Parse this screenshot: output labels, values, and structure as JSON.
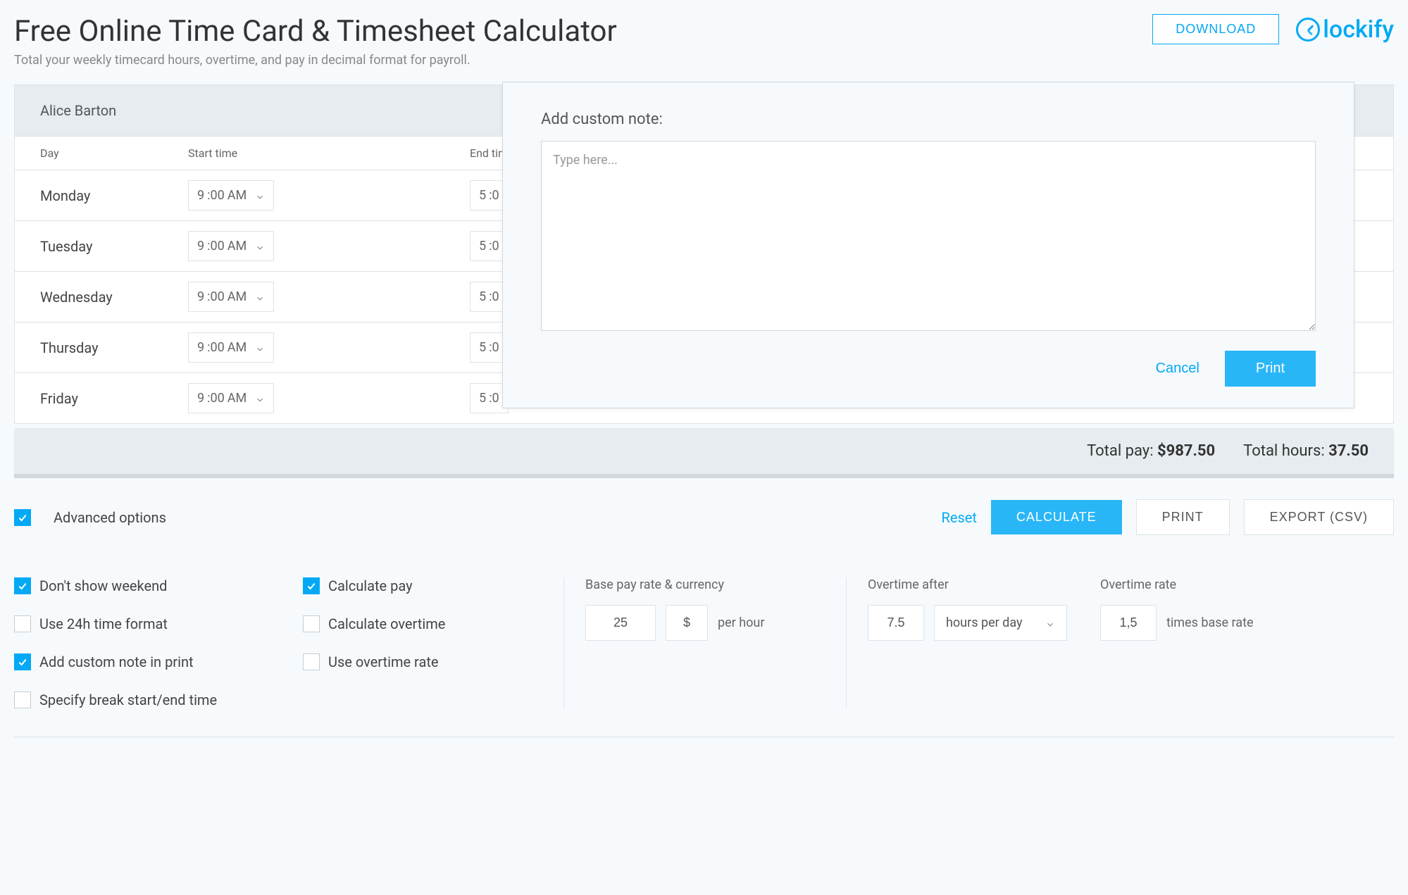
{
  "header": {
    "title": "Free Online Time Card & Timesheet Calculator",
    "subtitle": "Total your weekly timecard hours, overtime, and pay in decimal format for payroll.",
    "download": "DOWNLOAD",
    "brand": "lockify"
  },
  "timesheet": {
    "employee": "Alice Barton",
    "columns": {
      "day": "Day",
      "start": "Start time",
      "end": "End time"
    },
    "rows": [
      {
        "day": "Monday",
        "start_h": "9",
        "start_m": ":00",
        "start_ampm": "AM",
        "end_h": "5",
        "end_m": ":0"
      },
      {
        "day": "Tuesday",
        "start_h": "9",
        "start_m": ":00",
        "start_ampm": "AM",
        "end_h": "5",
        "end_m": ":0"
      },
      {
        "day": "Wednesday",
        "start_h": "9",
        "start_m": ":00",
        "start_ampm": "AM",
        "end_h": "5",
        "end_m": ":0"
      },
      {
        "day": "Thursday",
        "start_h": "9",
        "start_m": ":00",
        "start_ampm": "AM",
        "end_h": "5",
        "end_m": ":0"
      },
      {
        "day": "Friday",
        "start_h": "9",
        "start_m": ":00",
        "start_ampm": "AM",
        "end_h": "5",
        "end_m": ":0"
      }
    ]
  },
  "totals": {
    "pay_label": "Total pay:",
    "pay_value": "$987.50",
    "hours_label": "Total hours:",
    "hours_value": "37.50"
  },
  "actions": {
    "advanced": "Advanced options",
    "reset": "Reset",
    "calculate": "CALCULATE",
    "print": "PRINT",
    "export": "EXPORT (CSV)"
  },
  "options": {
    "dont_show_weekend": "Don't show weekend",
    "use_24h": "Use 24h time format",
    "add_note": "Add custom note in print",
    "specify_break": "Specify break start/end time",
    "calc_pay": "Calculate pay",
    "calc_overtime": "Calculate overtime",
    "use_ot_rate": "Use overtime rate",
    "base_rate_label": "Base pay rate & currency",
    "base_rate_value": "25",
    "currency": "$",
    "per_hour": "per hour",
    "ot_after_label": "Overtime after",
    "ot_after_value": "7.5",
    "ot_after_unit": "hours per day",
    "ot_rate_label": "Overtime rate",
    "ot_rate_value": "1,5",
    "ot_rate_suffix": "times base rate"
  },
  "modal": {
    "title": "Add custom note:",
    "placeholder": "Type here...",
    "cancel": "Cancel",
    "print": "Print"
  }
}
